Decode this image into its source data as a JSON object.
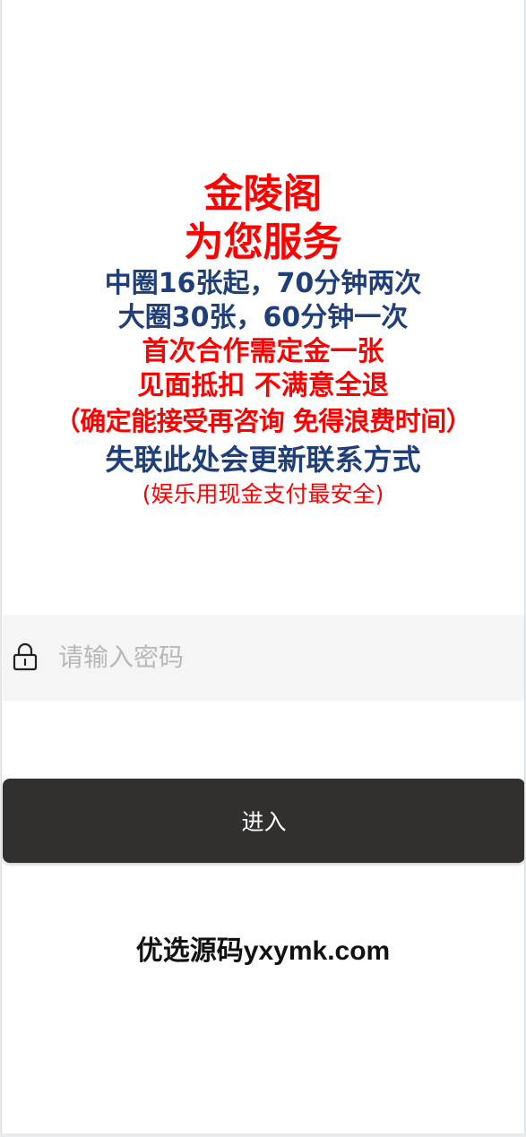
{
  "notice": {
    "title": "金陵阁",
    "subtitle": "为您服务",
    "line_1": "中圈16张起，70分钟两次",
    "line_2": "大圈30张，60分钟一次",
    "line_3": "首次合作需定金一张",
    "line_4": "见面抵扣 不满意全退",
    "line_5": "（确定能接受再咨询 免得浪费时间）",
    "line_6": "失联此处会更新联系方式",
    "line_7": "(娱乐用现金支付最安全)"
  },
  "login": {
    "password_placeholder": "请输入密码",
    "password_value": "",
    "enter_label": "进入",
    "lock_icon": "lock-icon"
  },
  "footer": {
    "text": "优选源码yxymk.com"
  },
  "colors": {
    "red": "#ff0000",
    "blue": "#1f3f7a",
    "button": "#322f2f",
    "input_background": "#f5f5f5"
  }
}
